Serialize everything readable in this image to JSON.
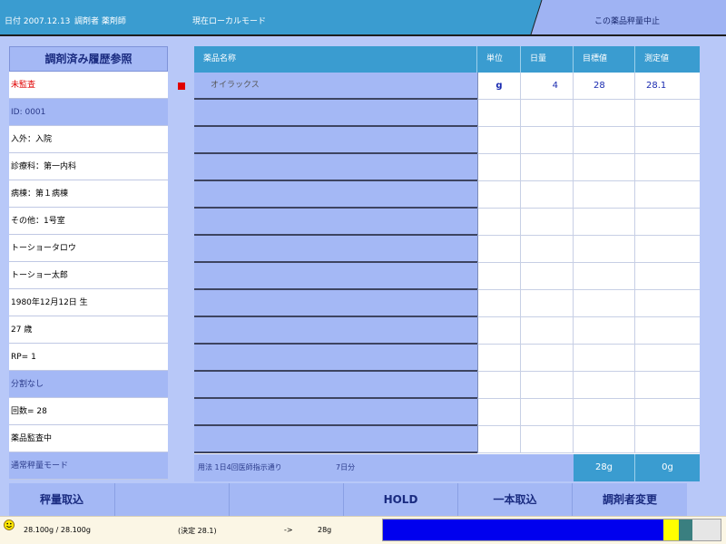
{
  "topbar": {
    "date": "日付 2007.12.13",
    "operator": "調剤者 薬剤師",
    "mode": "現在ローカルモード",
    "cancel_label": "この薬品秤量中止"
  },
  "left_panel": {
    "title": "調剤済み履歴参照",
    "rows": [
      "未監査",
      "ID: 0001",
      "入外：入院",
      "診療科：第一内科",
      "病棟：第１病棟",
      "その他：1号室",
      "トーショータロウ",
      "トーショー太郎",
      "1980年12月12日 生",
      " 27 歳",
      "RP= 1",
      "分割なし",
      "回数= 28",
      "薬品監査中",
      "通常秤量モード"
    ]
  },
  "table": {
    "headers": {
      "name": "薬品名称",
      "unit": "単位",
      "daily": "日量",
      "target": "目標値",
      "measured": "測定値"
    },
    "rows": [
      {
        "name": "オイラックス",
        "unit": "g",
        "daily": "4",
        "target": "28",
        "measured": "28.1"
      },
      {
        "name": "",
        "unit": "",
        "daily": "",
        "target": "",
        "measured": ""
      },
      {
        "name": "",
        "unit": "",
        "daily": "",
        "target": "",
        "measured": ""
      },
      {
        "name": "",
        "unit": "",
        "daily": "",
        "target": "",
        "measured": ""
      },
      {
        "name": "",
        "unit": "",
        "daily": "",
        "target": "",
        "measured": ""
      },
      {
        "name": "",
        "unit": "",
        "daily": "",
        "target": "",
        "measured": ""
      },
      {
        "name": "",
        "unit": "",
        "daily": "",
        "target": "",
        "measured": ""
      },
      {
        "name": "",
        "unit": "",
        "daily": "",
        "target": "",
        "measured": ""
      },
      {
        "name": "",
        "unit": "",
        "daily": "",
        "target": "",
        "measured": ""
      },
      {
        "name": "",
        "unit": "",
        "daily": "",
        "target": "",
        "measured": ""
      },
      {
        "name": "",
        "unit": "",
        "daily": "",
        "target": "",
        "measured": ""
      },
      {
        "name": "",
        "unit": "",
        "daily": "",
        "target": "",
        "measured": ""
      },
      {
        "name": "",
        "unit": "",
        "daily": "",
        "target": "",
        "measured": ""
      },
      {
        "name": "",
        "unit": "",
        "daily": "",
        "target": "",
        "measured": ""
      }
    ],
    "footer": {
      "usage": "用法 1日4回医師指示通り",
      "days": "7日分",
      "total": "28g",
      "measured": "0g"
    }
  },
  "buttons": {
    "weigh": "秤量取込",
    "blank1": "",
    "blank2": "",
    "hold": "HOLD",
    "single": "一本取込",
    "change_operator": "調剤者変更"
  },
  "status": {
    "weight": "28.100g   / 28.100g",
    "decided": "(決定   28.1)",
    "arrow": "->",
    "result": "28g",
    "icon": "smiley-icon",
    "progress": {
      "blue": 0.83,
      "yellow": 0.045,
      "teal": 0.04
    }
  },
  "colors": {
    "header": "#3a9cd0",
    "panel": "#a4b8f5",
    "marker": "#e00000",
    "progress_blue": "#0000ee",
    "progress_yellow": "#ffff00",
    "progress_teal": "#3a7f80"
  }
}
